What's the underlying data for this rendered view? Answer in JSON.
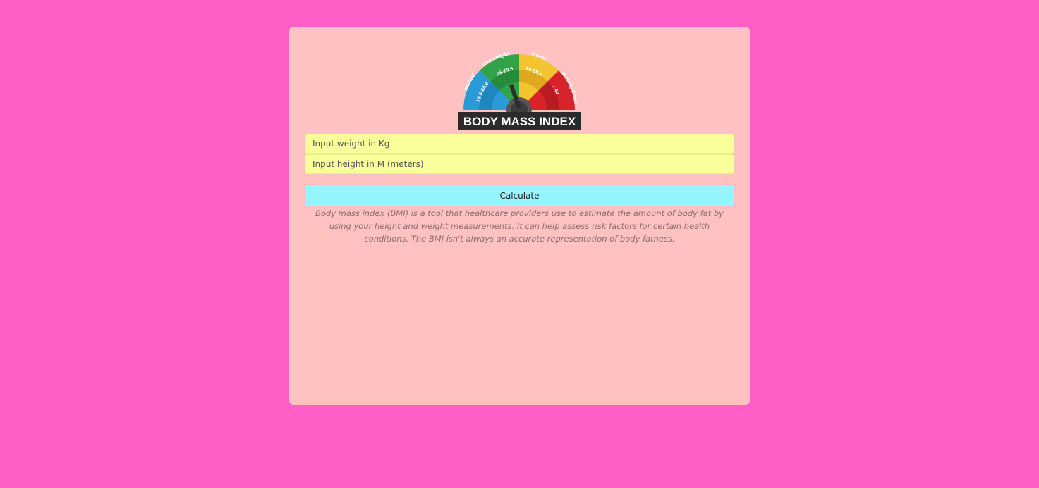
{
  "logo": {
    "banner_text": "BODY MASS INDEX",
    "zones": [
      {
        "label": "Normal",
        "range": "18.5-24.9",
        "color": "#2b9bd8"
      },
      {
        "label": "Overweight",
        "range": "25-29.9",
        "color": "#33a34a"
      },
      {
        "label": "Obese",
        "range": "30-39.9",
        "color": "#f4c430"
      },
      {
        "label": "Morbidly Obese",
        "range": "> 40",
        "color": "#d8232a"
      }
    ]
  },
  "form": {
    "weight_placeholder": "Input weight in Kg",
    "height_placeholder": "Input height in M (meters)",
    "calculate_label": "Calculate"
  },
  "description": "Body mass index (BMI) is a tool that healthcare providers use to estimate the amount of body fat by using your height and weight measurements. It can help assess risk factors for certain health conditions. The BMI isn't always an accurate representation of body fatness.",
  "colors": {
    "page_background": "#ff5fc6",
    "card_background": "#ffc2c1",
    "input_background": "#f9ff9a",
    "button_background": "#95f5fe"
  }
}
